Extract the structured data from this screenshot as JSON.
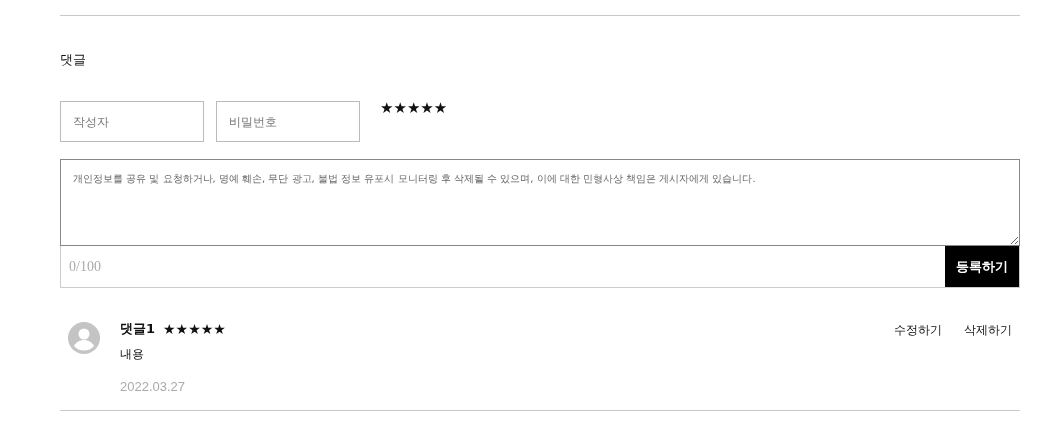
{
  "section_title": "댓글",
  "form": {
    "author": {
      "placeholder": "작성자"
    },
    "password": {
      "placeholder": "비밀번호"
    },
    "stars": 5,
    "comment": {
      "placeholder": "개인정보를 공유 및 요청하거나, 명예 훼손, 무단 광고, 불법 정보 유포시 모니터링 후 삭제될 수 있으며, 이에 대한 민형사상 책임은 게시자에게 있습니다."
    },
    "counter": "0/100",
    "submit": "등록하기"
  },
  "comments": [
    {
      "name": "댓글1",
      "stars": 5,
      "body": "내용",
      "date": "2022.03.27",
      "edit": "수정하기",
      "delete": "삭제하기"
    }
  ]
}
